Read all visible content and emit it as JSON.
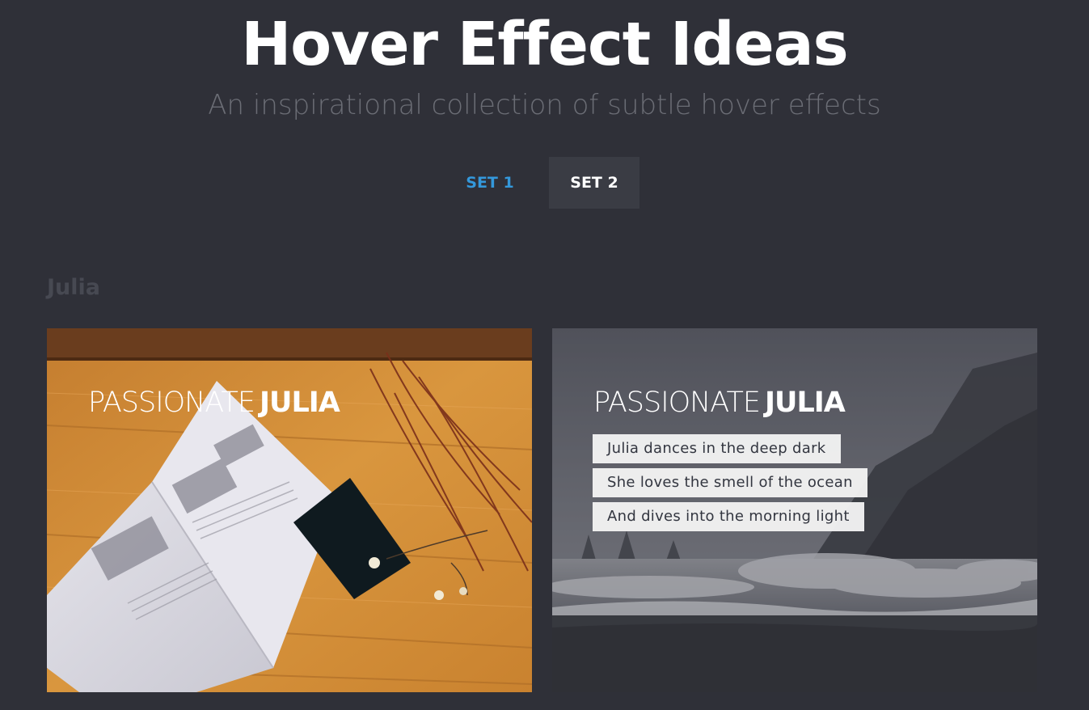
{
  "header": {
    "title": "Hover Effect Ideas",
    "subtitle": "An inspirational collection of subtle hover effects"
  },
  "nav": {
    "items": [
      {
        "label": "SET 1",
        "state": "link",
        "color": "#3498db"
      },
      {
        "label": "SET 2",
        "state": "current"
      }
    ]
  },
  "section": {
    "label": "Julia"
  },
  "grid": [
    {
      "title_thin": "PASSIONATE",
      "title_bold": "JULIA",
      "image": "book-on-wooden-table"
    },
    {
      "title_thin": "PASSIONATE",
      "title_bold": "JULIA",
      "image": "stormy-beach",
      "lines": [
        "Julia dances in the deep dark",
        "She loves the smell of the ocean",
        "And dives into the morning light"
      ]
    }
  ],
  "colors": {
    "background": "#2f3038",
    "accent": "#3498db",
    "active_tab": "#3a3c44"
  }
}
